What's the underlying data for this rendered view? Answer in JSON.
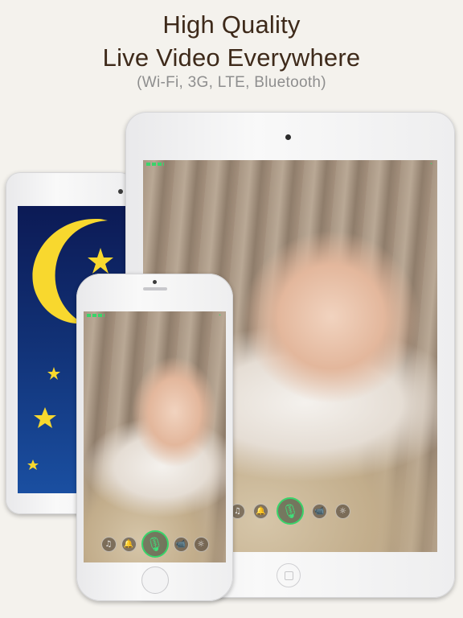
{
  "headline": {
    "line1": "High Quality",
    "line2": "Live Video Everywhere",
    "subtitle": "(Wi-Fi, 3G, LTE, Bluetooth)"
  },
  "controls": {
    "icons": [
      "music-icon",
      "bell-icon",
      "microphone-icon",
      "camera-icon",
      "brightness-icon"
    ],
    "glyphs": {
      "music": "♫",
      "bell": "🔔",
      "mic": "🎙",
      "camera": "📹",
      "brightness": "☼"
    },
    "mic_active_color": "#39d46a"
  },
  "status": {
    "wifi_glyph": "◔",
    "signal_color": "#39d46a"
  },
  "colors": {
    "background": "#f4f2ed",
    "headline": "#3e2a1a",
    "subtitle": "#8e8e8e",
    "moon": "#f8d82e"
  }
}
